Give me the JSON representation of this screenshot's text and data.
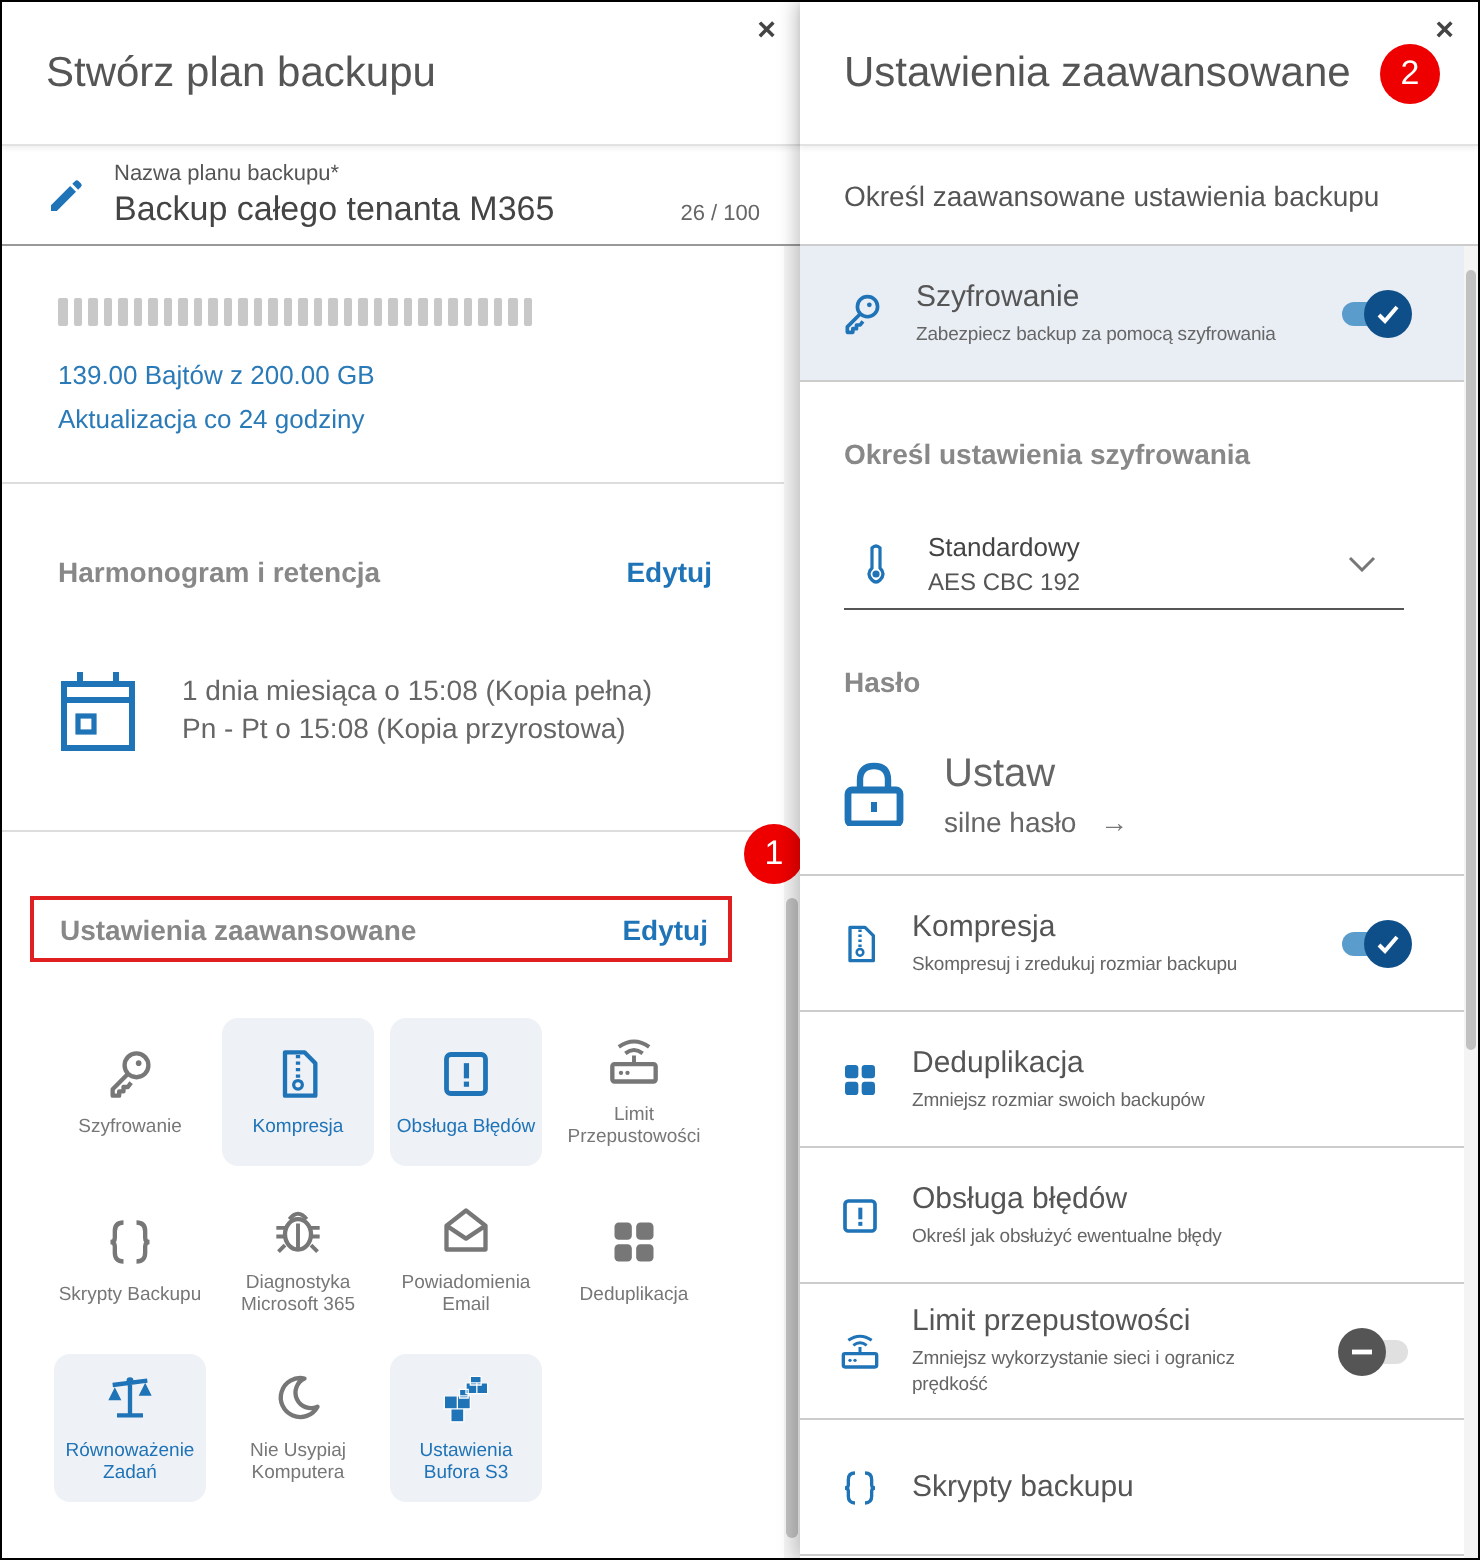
{
  "left_panel": {
    "title": "Stwórz plan backupu",
    "close": "×",
    "name_field": {
      "label": "Nazwa planu backupu*",
      "value": "Backup całego tenanta M365",
      "counter": "26 / 100"
    },
    "usage": {
      "amount": "139.00 Bajtów z 200.00 GB",
      "update": "Aktualizacja co 24 godziny"
    },
    "schedule": {
      "title": "Harmonogram i retencja",
      "edit": "Edytuj",
      "lines": [
        "1 dnia miesiąca o 15:08 (Kopia pełna)",
        "Pn - Pt o 15:08 (Kopia przyrostowa)"
      ]
    },
    "advanced": {
      "title": "Ustawienia zaawansowane",
      "edit": "Edytuj",
      "highlighted": true,
      "callout": "1",
      "features": [
        {
          "label": "Szyfrowanie",
          "selected": false
        },
        {
          "label": "Kompresja",
          "selected": true
        },
        {
          "label": "Obsługa Błędów",
          "selected": true
        },
        {
          "label": "Limit Przepustowości",
          "selected": false
        },
        {
          "label": "Skrypty Backupu",
          "selected": false
        },
        {
          "label": "Diagnostyka Microsoft 365",
          "selected": false
        },
        {
          "label": "Powiadomienia Email",
          "selected": false
        },
        {
          "label": "Deduplikacja",
          "selected": false
        },
        {
          "label": "Równoważenie Zadań",
          "selected": true
        },
        {
          "label": "Nie Usypiaj Komputera",
          "selected": false
        },
        {
          "label": "Ustawienia Bufora S3",
          "selected": true
        }
      ]
    }
  },
  "right_panel": {
    "title": "Ustawienia zaawansowane",
    "callout": "2",
    "close": "×",
    "subtitle": "Określ zaawansowane ustawienia backupu",
    "encryption": {
      "title": "Szyfrowanie",
      "description": "Zabezpiecz backup za pomocą szyfrowania",
      "on": true,
      "selected": true
    },
    "encryption_section": "Określ ustawienia szyfrowania",
    "encryption_dropdown": {
      "value": "Standardowy",
      "detail": "AES CBC 192"
    },
    "password": {
      "section": "Hasło",
      "title": "Ustaw",
      "subtitle": "silne hasło",
      "arrow": "→"
    },
    "options": [
      {
        "kind": "toggle",
        "title": "Kompresja",
        "description": "Skompresuj i zredukuj rozmiar backupu",
        "on": true
      },
      {
        "kind": "link",
        "title": "Deduplikacja",
        "description": "Zmniejsz rozmiar swoich backupów"
      },
      {
        "kind": "link",
        "title": "Obsługa błędów",
        "description": "Określ jak obsłużyć ewentualne błędy"
      },
      {
        "kind": "toggle",
        "title": "Limit przepustowości",
        "description": "Zmniejsz wykorzystanie sieci i ogranicz prędkość",
        "on": false
      },
      {
        "kind": "link",
        "title": "Skrypty backupu"
      }
    ]
  }
}
